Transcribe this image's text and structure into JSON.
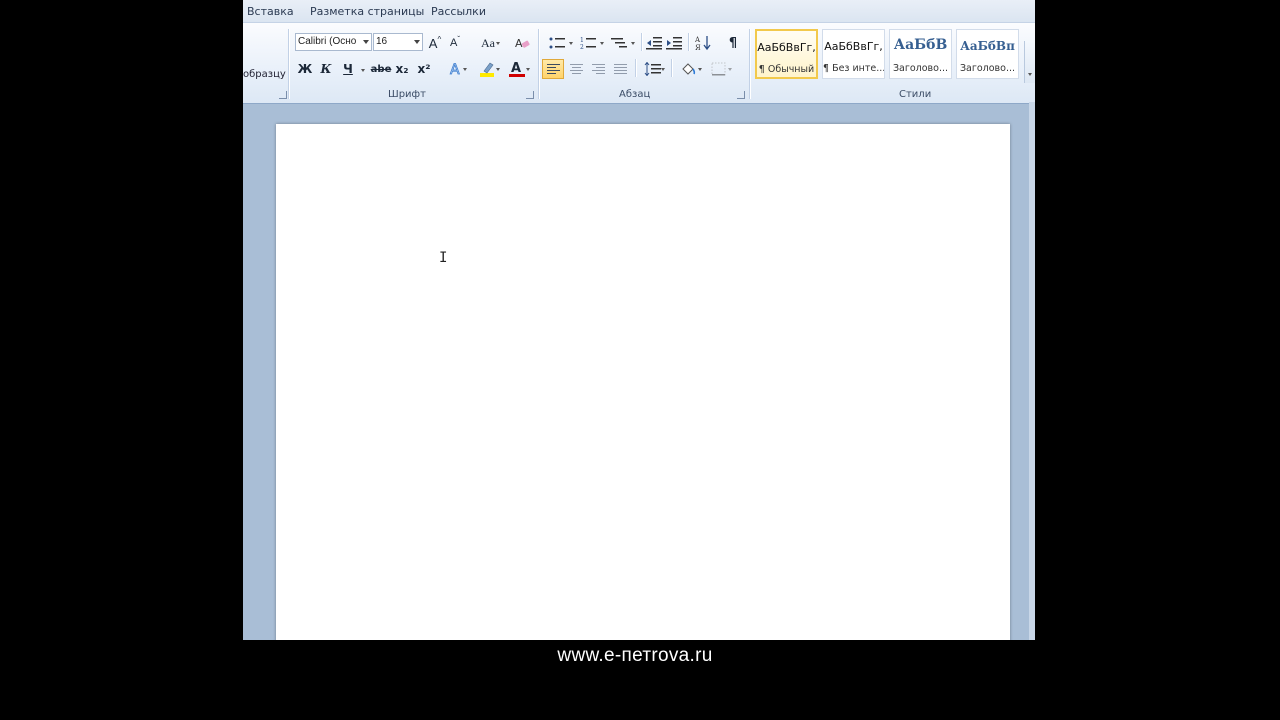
{
  "tabs": [
    "Вставка",
    "Разметка страницы",
    "Рассылки"
  ],
  "clipboard": {
    "label_fragment": "образцу"
  },
  "font": {
    "group_label": "Шрифт",
    "font_name": "Calibri (Осно",
    "font_size": "16",
    "grow_label": "A",
    "shrink_label": "A",
    "case_label": "Aa",
    "bold_label": "Ж",
    "italic_label": "К",
    "underline_label": "Ч",
    "strike_label": "abe",
    "subscript_label": "x₂",
    "superscript_label": "x²",
    "color_label": "A"
  },
  "paragraph": {
    "group_label": "Абзац",
    "pilcrow": "¶"
  },
  "styles": {
    "group_label": "Стили",
    "items": [
      {
        "sample": "АаБбВвГг,",
        "name": "¶ Обычный",
        "selected": true
      },
      {
        "sample": "АаБбВвГг,",
        "name": "¶ Без инте..."
      },
      {
        "sample": "АаБбВ",
        "name": "Заголово..."
      },
      {
        "sample": "АаБбВп",
        "name": "Заголово..."
      }
    ]
  },
  "colors": {
    "highlight": "#ffea00",
    "font_color": "#d00000",
    "selected_style_border": "#f2c94c"
  },
  "cursor_glyph": "I",
  "watermark": "www.e-петrova.ru"
}
